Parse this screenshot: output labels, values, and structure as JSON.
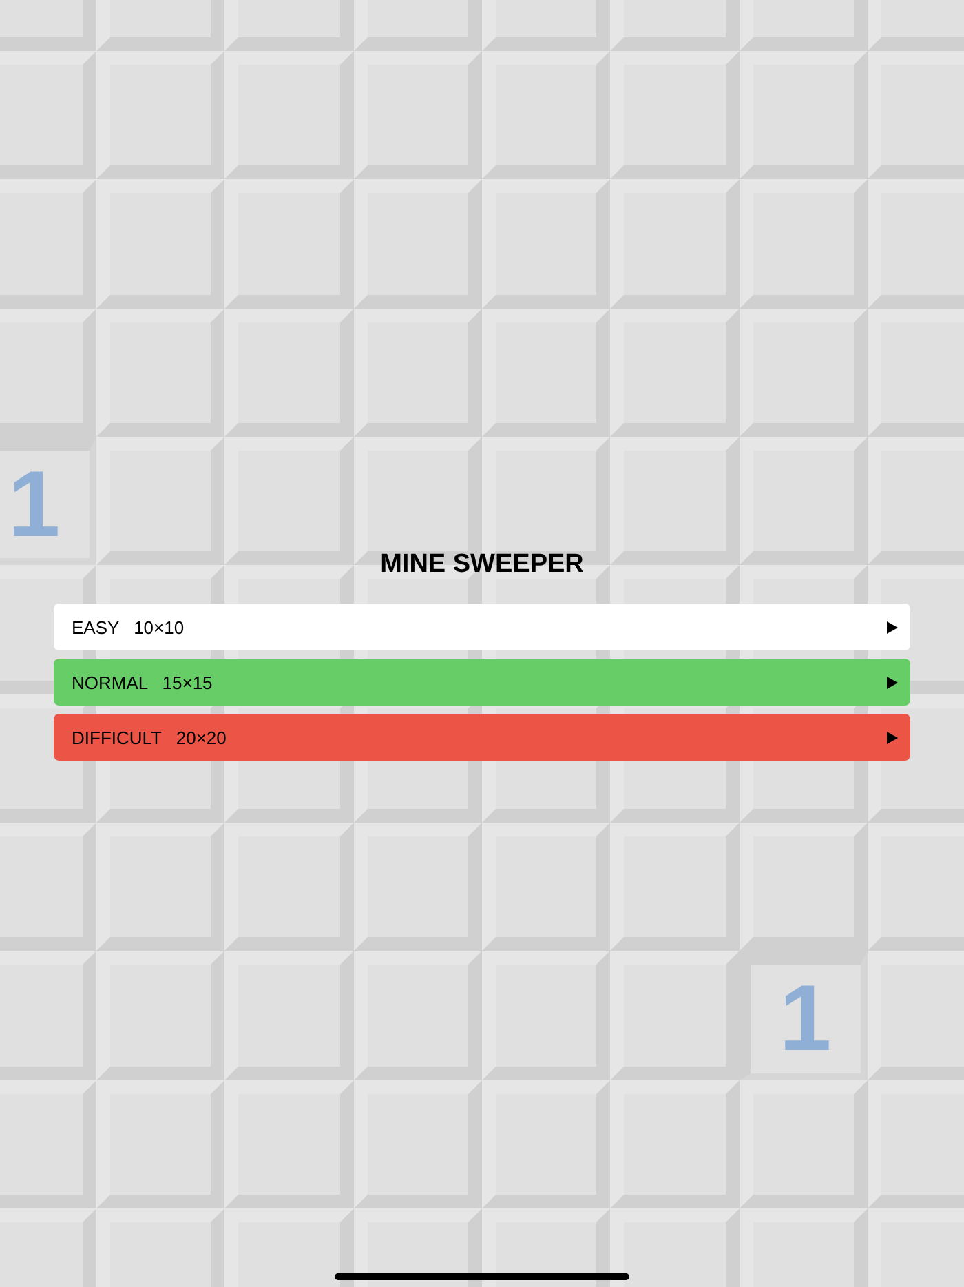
{
  "board": {
    "rows": [
      [
        {
          "revealed": false
        },
        {
          "revealed": false
        },
        {
          "revealed": false
        },
        {
          "revealed": false
        },
        {
          "revealed": false
        },
        {
          "revealed": false
        },
        {
          "revealed": false
        },
        {
          "revealed": false
        }
      ],
      [
        {
          "revealed": false
        },
        {
          "revealed": false
        },
        {
          "revealed": false
        },
        {
          "revealed": false
        },
        {
          "revealed": false
        },
        {
          "revealed": false
        },
        {
          "revealed": false
        },
        {
          "revealed": false
        }
      ],
      [
        {
          "revealed": false
        },
        {
          "revealed": false
        },
        {
          "revealed": false
        },
        {
          "revealed": false
        },
        {
          "revealed": false
        },
        {
          "revealed": false
        },
        {
          "revealed": false
        },
        {
          "revealed": false
        }
      ],
      [
        {
          "revealed": false
        },
        {
          "revealed": false
        },
        {
          "revealed": false
        },
        {
          "revealed": false
        },
        {
          "revealed": false
        },
        {
          "revealed": false
        },
        {
          "revealed": false
        },
        {
          "revealed": false
        }
      ],
      [
        {
          "revealed": true,
          "number": "1"
        },
        {
          "revealed": false
        },
        {
          "revealed": false
        },
        {
          "revealed": false
        },
        {
          "revealed": false
        },
        {
          "revealed": false
        },
        {
          "revealed": false
        },
        {
          "revealed": false
        }
      ],
      [
        {
          "revealed": false
        },
        {
          "revealed": false
        },
        {
          "revealed": false
        },
        {
          "revealed": false
        },
        {
          "revealed": false
        },
        {
          "revealed": false
        },
        {
          "revealed": false
        },
        {
          "revealed": false
        }
      ],
      [
        {
          "revealed": false
        },
        {
          "revealed": false
        },
        {
          "revealed": false
        },
        {
          "revealed": false
        },
        {
          "revealed": false
        },
        {
          "revealed": false
        },
        {
          "revealed": false
        },
        {
          "revealed": false
        }
      ],
      [
        {
          "revealed": false
        },
        {
          "revealed": false
        },
        {
          "revealed": false
        },
        {
          "revealed": false
        },
        {
          "revealed": false
        },
        {
          "revealed": false
        },
        {
          "revealed": false
        },
        {
          "revealed": false
        }
      ],
      [
        {
          "revealed": false
        },
        {
          "revealed": false
        },
        {
          "revealed": false
        },
        {
          "revealed": false
        },
        {
          "revealed": false
        },
        {
          "revealed": false
        },
        {
          "revealed": true,
          "number": "1"
        },
        {
          "revealed": false
        }
      ],
      [
        {
          "revealed": false
        },
        {
          "revealed": false
        },
        {
          "revealed": false
        },
        {
          "revealed": false
        },
        {
          "revealed": false
        },
        {
          "revealed": false
        },
        {
          "revealed": false
        },
        {
          "revealed": false
        }
      ],
      [
        {
          "revealed": false
        },
        {
          "revealed": false
        },
        {
          "revealed": false
        },
        {
          "revealed": false
        },
        {
          "revealed": false
        },
        {
          "revealed": false
        },
        {
          "revealed": false
        },
        {
          "revealed": false
        }
      ]
    ]
  },
  "title": "MINE SWEEPER",
  "levels": [
    {
      "label": "EASY",
      "size": "10×10",
      "color": "#ffffff"
    },
    {
      "label": "NORMAL",
      "size": "15×15",
      "color": "#67ce67"
    },
    {
      "label": "DIFFICULT",
      "size": "20×20",
      "color": "#ec5446"
    }
  ]
}
